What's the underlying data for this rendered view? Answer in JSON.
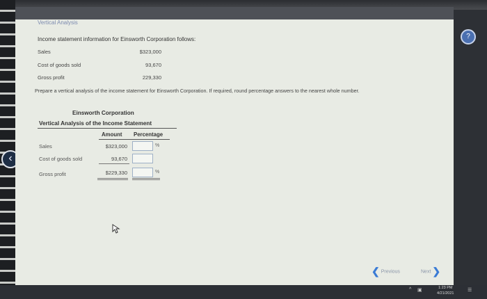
{
  "header": {
    "section_title": "Vertical Analysis"
  },
  "intro": "Income statement information for Einsworth Corporation follows:",
  "income_info": [
    {
      "label": "Sales",
      "value": "$323,000"
    },
    {
      "label": "Cost of goods sold",
      "value": "93,670"
    },
    {
      "label": "Gross profit",
      "value": "229,330"
    }
  ],
  "instruction": "Prepare a vertical analysis of the income statement for Einsworth Corporation. If required, round percentage answers to the nearest whole number.",
  "report": {
    "company": "Einsworth Corporation",
    "title": "Vertical Analysis of the Income Statement",
    "col_amount": "Amount",
    "col_percentage": "Percentage",
    "rows": [
      {
        "label": "Sales",
        "amount": "$323,000",
        "percent_value": "",
        "percent_sign": "%"
      },
      {
        "label": "Cost of goods sold",
        "amount": "93,670",
        "percent_value": "",
        "percent_sign": ""
      },
      {
        "label": "Gross profit",
        "amount": "$229,330",
        "percent_value": "",
        "percent_sign": "%"
      }
    ]
  },
  "nav": {
    "previous": "Previous",
    "next": "Next"
  },
  "taskbar": {
    "time": "1:23 PM",
    "date": "4/21/2021"
  },
  "icons": {
    "back": "chevron-left-icon",
    "help": "help-icon",
    "cursor": "mouse-cursor-icon",
    "prev": "chevron-left-icon",
    "next": "chevron-right-icon"
  },
  "colors": {
    "accent": "#3a7bd5",
    "input_border": "#9eb0c6"
  }
}
